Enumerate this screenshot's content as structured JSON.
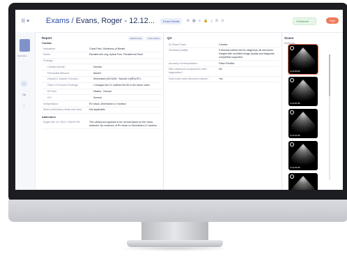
{
  "header": {
    "title_prefix": "Exams",
    "title_sep": " / ",
    "title_patient": "Evans, Roger - 12.12...",
    "exam_details": "Exam Details",
    "status": "Published",
    "sign": "Sign"
  },
  "nav": {
    "avatar_label": "Username",
    "items": [
      "⌂",
      "Ok",
      "!"
    ]
  },
  "report": {
    "title": "Report",
    "btn_attach": "Attachments",
    "btn_history": "View History",
    "section_cardiac": "Cardiac",
    "rows": [
      {
        "k": "Indications:",
        "v": "Chest Pain, Shortness of Breath",
        "cls": ""
      },
      {
        "k": "Views:",
        "v": "Parasternal Long, Apical Four, Parasternal Short",
        "cls": ""
      },
      {
        "k": "Findings:",
        "v": "",
        "cls": ""
      },
      {
        "k": "Cardiac Activity:",
        "v": "Normal",
        "cls": "sub"
      },
      {
        "k": "Pericardial Effusion:",
        "v": "Absent",
        "cls": "sub"
      },
      {
        "k": "Global LV Systolic Function:",
        "v": "Decreased (Mi DATA · Normal 3 (MRI) EF)",
        "cls": "sub",
        "red": true
      },
      {
        "k": "Other LV Function Findings:",
        "v": "I changed the LV outlined the tilt in the frame notes.",
        "cls": "sub",
        "red": true
      },
      {
        "k": "RV Size:",
        "v": "Dilated · Normal",
        "cls": "sub"
      },
      {
        "k": "IVC:",
        "v": "Normal",
        "cls": "sub"
      },
      {
        "k": "Interpretation:",
        "v": "RV strain, Diminished LV function",
        "cls": ""
      },
      {
        "k": "What confirmatory study was done:",
        "v": "Not applicable",
        "cls": ""
      }
    ],
    "section_addendum": "Addendum",
    "addendum": {
      "k": "Roger Dec 12, 2022, 2:30:00 PM",
      "v": "This ultrasound appears to be normal based on the views obtained. No evidence of RV strain or Diminished LV function."
    }
  },
  "qa": {
    "title": "QA",
    "rows": [
      {
        "k": "Qr Report Type:",
        "v": "Cardiac"
      },
      {
        "k": "Technical Quality:",
        "v": "5 Minimal criteria met for diagnosis; all structures imaged with excellent image quality and diagnosis completely supported"
      },
      {
        "k": "Accuracy of Interpretation:",
        "v": "False Positive"
      },
      {
        "k": "Was ultrasound compared to other diagnostics?:",
        "v": "No"
      },
      {
        "k": "Does exam meet Minimum criteria?:",
        "v": "Yes"
      }
    ]
  },
  "scans": {
    "title": "Scans",
    "subtitle": "Heart scan",
    "items": [
      {
        "time": "12:11:55 PM"
      },
      {
        "time": "12:12:05 PM"
      },
      {
        "time": "12:12:33 PM"
      },
      {
        "time": "12:12:45 PM"
      },
      {
        "time": ""
      }
    ]
  }
}
